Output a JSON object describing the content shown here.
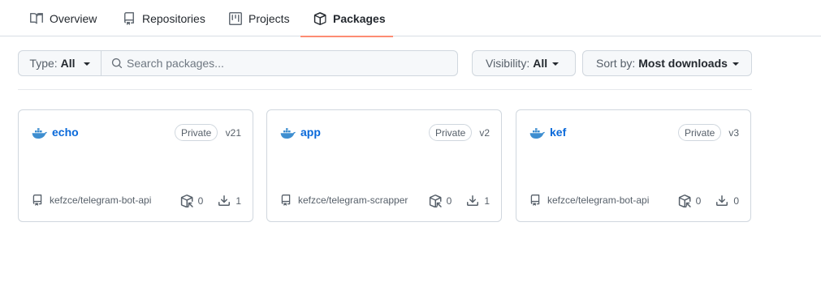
{
  "tabs": [
    {
      "label": "Overview",
      "icon": "book-icon",
      "active": false
    },
    {
      "label": "Repositories",
      "icon": "repo-icon",
      "active": false
    },
    {
      "label": "Projects",
      "icon": "project-icon",
      "active": false
    },
    {
      "label": "Packages",
      "icon": "package-icon",
      "active": true
    }
  ],
  "filters": {
    "type_label": "Type:",
    "type_value": "All",
    "search_placeholder": "Search packages...",
    "visibility_label": "Visibility:",
    "visibility_value": "All",
    "sort_label": "Sort by:",
    "sort_value": "Most downloads"
  },
  "packages": [
    {
      "name": "echo",
      "visibility": "Private",
      "version": "v21",
      "repo": "kefzce/telegram-bot-api",
      "dependents": "0",
      "downloads": "1",
      "icon": "docker-icon"
    },
    {
      "name": "app",
      "visibility": "Private",
      "version": "v2",
      "repo": "kefzce/telegram-scrapper",
      "dependents": "0",
      "downloads": "1",
      "icon": "docker-icon"
    },
    {
      "name": "kef",
      "visibility": "Private",
      "version": "v3",
      "repo": "kefzce/telegram-bot-api",
      "dependents": "0",
      "downloads": "0",
      "icon": "docker-icon"
    }
  ],
  "colors": {
    "accent_link": "#0969da",
    "tab_underline": "#fd8c73",
    "docker_blue": "#3e8ed0"
  }
}
